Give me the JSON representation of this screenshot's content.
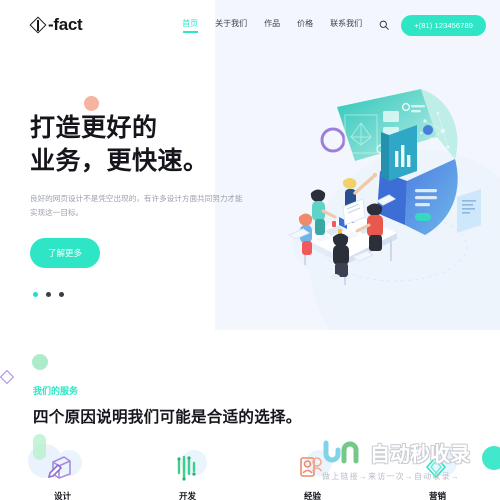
{
  "site": {
    "logo_text": "-fact",
    "logo_icon": "diamond-logo-icon"
  },
  "header": {
    "nav": [
      {
        "label": "首页",
        "active": true
      },
      {
        "label": "关于我们",
        "active": false
      },
      {
        "label": "作品",
        "active": false
      },
      {
        "label": "价格",
        "active": false
      },
      {
        "label": "联系我们",
        "active": false
      }
    ],
    "search_icon": "search-icon",
    "phone_button": "+(81) 123456789"
  },
  "hero": {
    "title_line1": "打造更好的",
    "title_line2": "业务，更快速。",
    "subtitle": "良好的网页设计不是凭空出现的，有许多设计方面共同努力才能实现这一目标。",
    "cta_label": "了解更多",
    "carousel": {
      "count": 3,
      "active_index": 0
    },
    "illustration": "team-meeting-isometric-illustration"
  },
  "services": {
    "eyebrow": "我们的服务",
    "heading": "四个原因说明我们可能是合适的选择。",
    "items": [
      {
        "name": "设计",
        "icon": "design-pen-icon",
        "color": "#a98ae0"
      },
      {
        "name": "开发",
        "icon": "code-bars-icon",
        "color": "#3ecf8e"
      },
      {
        "name": "经验",
        "icon": "user-card-icon",
        "color": "#f08a6c"
      },
      {
        "name": "营销",
        "icon": "marketing-megaphone-icon",
        "color": "#2ee6c5"
      }
    ]
  },
  "watermark": {
    "title": "自动秒收录",
    "subtitle": "做上链接→来访一次→自动收录→",
    "logo_icon": "jn-watermark-logo-icon"
  },
  "colors": {
    "accent": "#2ee6c5",
    "text_dark": "#14161c",
    "text_muted": "#9aa0ad",
    "hero_bg": "#f3f7fd"
  }
}
